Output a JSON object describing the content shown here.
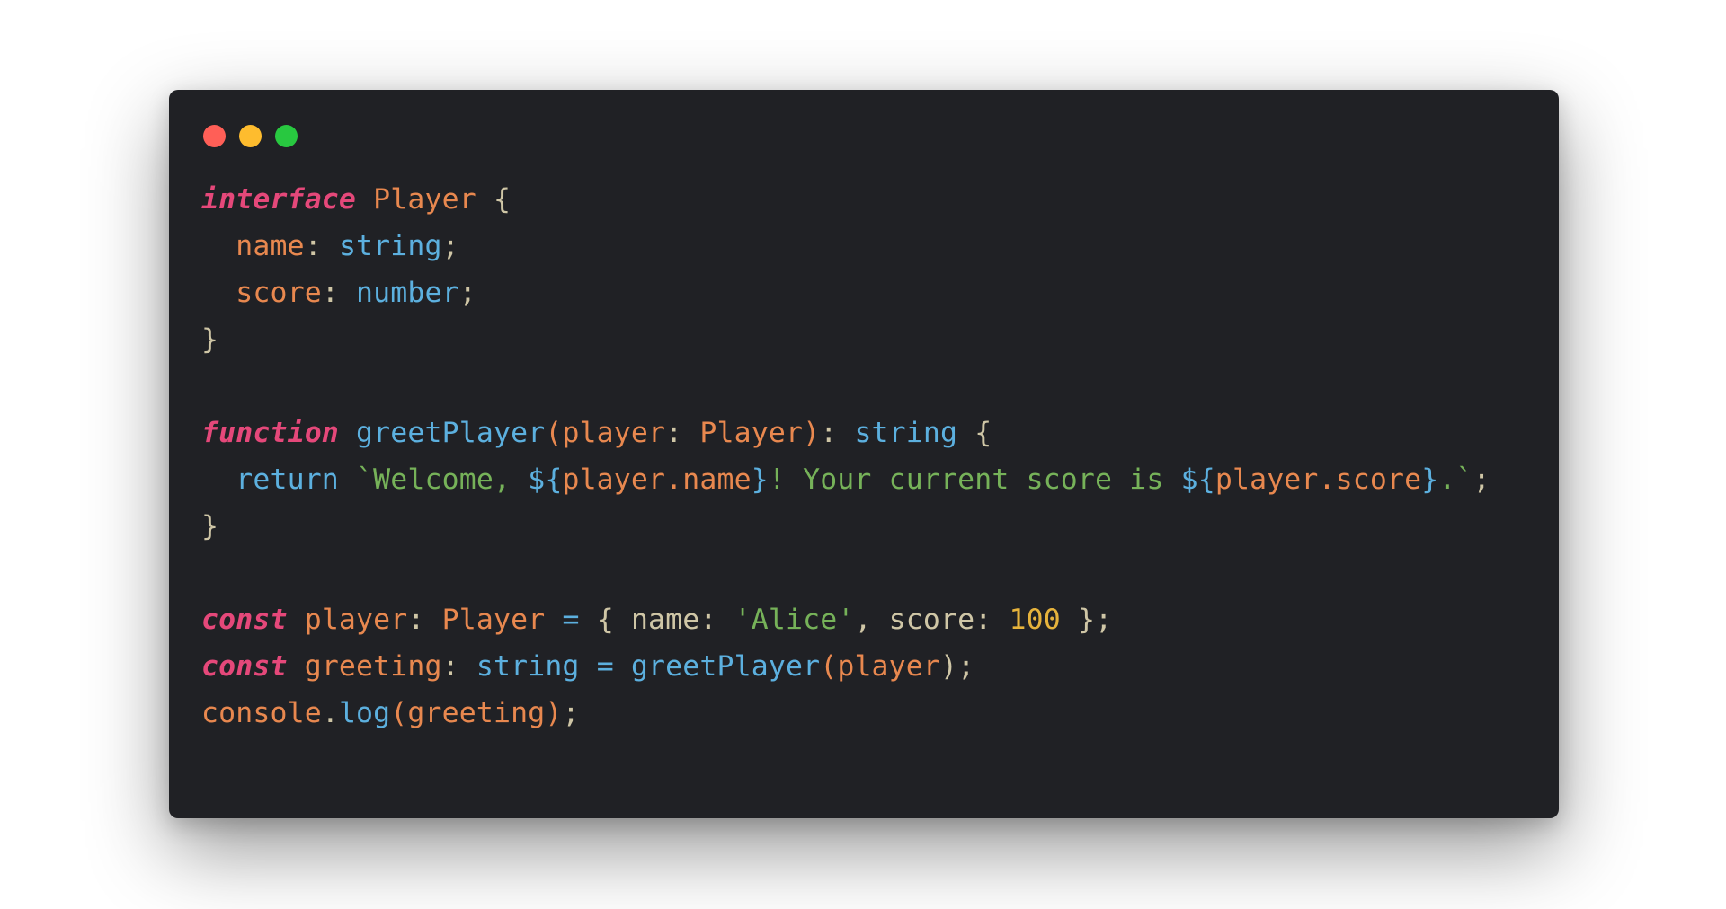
{
  "colors": {
    "background": "#ffffff",
    "window": "#202125",
    "traffic_red": "#ff5f57",
    "traffic_yellow": "#febc2e",
    "traffic_green": "#28c840",
    "keyword": "#e5487a",
    "identifier": "#e8884f",
    "type": "#5cb0df",
    "string": "#76b259",
    "number": "#e6b33c",
    "punctuation": "#cfc6a6"
  },
  "traffic_lights": [
    "close-dot",
    "minimize-dot",
    "zoom-dot"
  ],
  "code_lines": [
    [
      {
        "text": "interface",
        "kind": "keyword"
      },
      {
        "text": " ",
        "kind": "punctuation"
      },
      {
        "text": "Player",
        "kind": "identifier"
      },
      {
        "text": " {",
        "kind": "punctuation"
      }
    ],
    [
      {
        "text": "  ",
        "kind": "punctuation"
      },
      {
        "text": "name",
        "kind": "identifier"
      },
      {
        "text": ": ",
        "kind": "punctuation"
      },
      {
        "text": "string",
        "kind": "type"
      },
      {
        "text": ";",
        "kind": "punctuation"
      }
    ],
    [
      {
        "text": "  ",
        "kind": "punctuation"
      },
      {
        "text": "score",
        "kind": "identifier"
      },
      {
        "text": ": ",
        "kind": "punctuation"
      },
      {
        "text": "number",
        "kind": "type"
      },
      {
        "text": ";",
        "kind": "punctuation"
      }
    ],
    [
      {
        "text": "}",
        "kind": "punctuation"
      }
    ],
    [],
    [
      {
        "text": "function",
        "kind": "keyword"
      },
      {
        "text": " ",
        "kind": "punctuation"
      },
      {
        "text": "greetPlayer",
        "kind": "type"
      },
      {
        "text": "(",
        "kind": "identifier"
      },
      {
        "text": "player",
        "kind": "identifier"
      },
      {
        "text": ": ",
        "kind": "punctuation"
      },
      {
        "text": "Player",
        "kind": "identifier"
      },
      {
        "text": ")",
        "kind": "identifier"
      },
      {
        "text": ": ",
        "kind": "punctuation"
      },
      {
        "text": "string",
        "kind": "type"
      },
      {
        "text": " {",
        "kind": "punctuation"
      }
    ],
    [
      {
        "text": "  ",
        "kind": "punctuation"
      },
      {
        "text": "return",
        "kind": "type"
      },
      {
        "text": " ",
        "kind": "punctuation"
      },
      {
        "text": "`Welcome, ",
        "kind": "string"
      },
      {
        "text": "${",
        "kind": "type"
      },
      {
        "text": "player.name",
        "kind": "identifier"
      },
      {
        "text": "}",
        "kind": "type"
      },
      {
        "text": "! Your current score is ",
        "kind": "string"
      },
      {
        "text": "${",
        "kind": "type"
      },
      {
        "text": "player.score",
        "kind": "identifier"
      },
      {
        "text": "}",
        "kind": "type"
      },
      {
        "text": ".`",
        "kind": "string"
      },
      {
        "text": ";",
        "kind": "punctuation"
      }
    ],
    [
      {
        "text": "}",
        "kind": "punctuation"
      }
    ],
    [],
    [
      {
        "text": "const",
        "kind": "keyword"
      },
      {
        "text": " ",
        "kind": "punctuation"
      },
      {
        "text": "player",
        "kind": "identifier"
      },
      {
        "text": ": ",
        "kind": "punctuation"
      },
      {
        "text": "Player",
        "kind": "identifier"
      },
      {
        "text": " ",
        "kind": "punctuation"
      },
      {
        "text": "=",
        "kind": "type"
      },
      {
        "text": " { name: ",
        "kind": "punctuation"
      },
      {
        "text": "'Alice'",
        "kind": "string"
      },
      {
        "text": ", score: ",
        "kind": "punctuation"
      },
      {
        "text": "100",
        "kind": "number"
      },
      {
        "text": " };",
        "kind": "punctuation"
      }
    ],
    [
      {
        "text": "const",
        "kind": "keyword"
      },
      {
        "text": " ",
        "kind": "punctuation"
      },
      {
        "text": "greeting",
        "kind": "identifier"
      },
      {
        "text": ": ",
        "kind": "punctuation"
      },
      {
        "text": "string",
        "kind": "type"
      },
      {
        "text": " ",
        "kind": "punctuation"
      },
      {
        "text": "=",
        "kind": "type"
      },
      {
        "text": " ",
        "kind": "punctuation"
      },
      {
        "text": "greetPlayer",
        "kind": "type"
      },
      {
        "text": "(",
        "kind": "identifier"
      },
      {
        "text": "player",
        "kind": "identifier"
      },
      {
        "text": ");",
        "kind": "punctuation"
      }
    ],
    [
      {
        "text": "console",
        "kind": "identifier"
      },
      {
        "text": ".",
        "kind": "punctuation"
      },
      {
        "text": "log",
        "kind": "type"
      },
      {
        "text": "(",
        "kind": "identifier"
      },
      {
        "text": "greeting",
        "kind": "identifier"
      },
      {
        "text": ")",
        "kind": "identifier"
      },
      {
        "text": ";",
        "kind": "punctuation"
      }
    ]
  ]
}
